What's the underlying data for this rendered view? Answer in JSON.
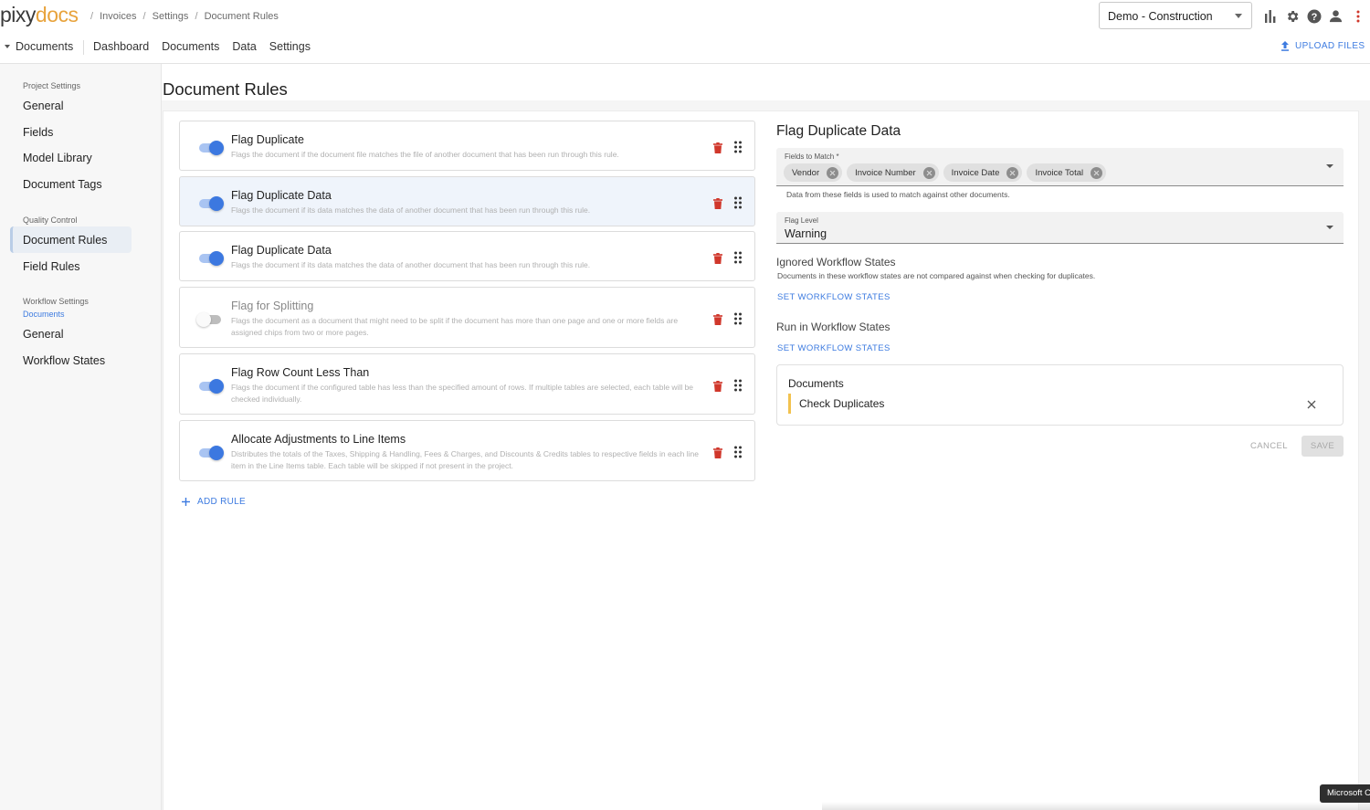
{
  "header": {
    "logo_pre": "pixy",
    "logo_post": "docs",
    "breadcrumbs": [
      "Invoices",
      "Settings",
      "Document Rules"
    ],
    "breadcrumb_sep": "/",
    "project": "Demo - Construction"
  },
  "nav": {
    "dropdown": "Documents",
    "links": [
      "Dashboard",
      "Documents",
      "Data",
      "Settings"
    ],
    "upload": "UPLOAD FILES"
  },
  "sidebar": {
    "project_settings_label": "Project Settings",
    "project_items": [
      "General",
      "Fields",
      "Model Library",
      "Document Tags"
    ],
    "quality_label": "Quality Control",
    "quality_items": [
      "Document Rules",
      "Field Rules"
    ],
    "workflow_label": "Workflow Settings",
    "workflow_sub": "Documents",
    "workflow_items": [
      "General",
      "Workflow States"
    ]
  },
  "main": {
    "title": "Document Rules",
    "add_rule": "ADD RULE",
    "rules": [
      {
        "title": "Flag Duplicate",
        "desc": "Flags the document if the document file matches the file of another document that has been run through this rule.",
        "enabled": true
      },
      {
        "title": "Flag Duplicate Data",
        "desc": "Flags the document if its data matches the data of another document that has been run through this rule.",
        "enabled": true
      },
      {
        "title": "Flag Duplicate Data",
        "desc": "Flags the document if its data matches the data of another document that has been run through this rule.",
        "enabled": true
      },
      {
        "title": "Flag for Splitting",
        "desc": "Flags the document as a document that might need to be split if the document has more than one page and one or more fields are assigned chips from two or more pages.",
        "enabled": false
      },
      {
        "title": "Flag Row Count Less Than",
        "desc": "Flags the document if the configured table has less than the specified amount of rows. If multiple tables are selected, each table will be checked individually.",
        "enabled": true
      },
      {
        "title": "Allocate Adjustments to Line Items",
        "desc": "Distributes the totals of the Taxes, Shipping & Handling, Fees & Charges, and Discounts & Credits tables to respective fields in each line item in the Line Items table. Each table will be skipped if not present in the project.",
        "enabled": true
      }
    ]
  },
  "detail": {
    "title": "Flag Duplicate Data",
    "fields_label": "Fields to Match *",
    "chips": [
      "Vendor",
      "Invoice Number",
      "Invoice Date",
      "Invoice Total"
    ],
    "fields_helper": "Data from these fields is used to match against other documents.",
    "flag_level_label": "Flag Level",
    "flag_level_value": "Warning",
    "ignored_title": "Ignored Workflow States",
    "ignored_desc": "Documents in these workflow states are not compared against when checking for duplicates.",
    "set_states": "SET WORKFLOW STATES",
    "run_title": "Run in Workflow States",
    "card_title": "Documents",
    "card_item": "Check Duplicates",
    "cancel": "CANCEL",
    "save": "SAVE"
  },
  "toast": "Microsoft C",
  "colors": {
    "accent": "#3d7be0",
    "toggle_on": "#3c78e0",
    "delete": "#d0372b",
    "state_marker": "#f2c24f"
  }
}
